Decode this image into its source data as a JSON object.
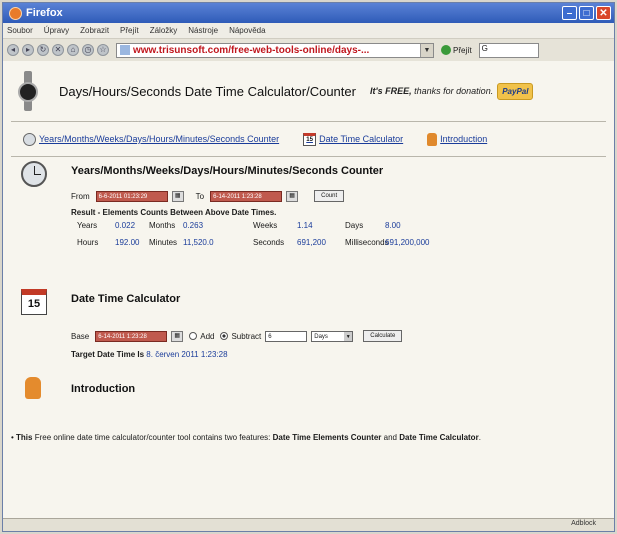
{
  "window": {
    "title": "Firefox"
  },
  "menu": [
    "Soubor",
    "Úpravy",
    "Zobrazit",
    "Přejít",
    "Záložky",
    "Nástroje",
    "Nápověda"
  ],
  "nav": {
    "url": "www.trisunsoft.com/free-web-tools-online/days-...",
    "go_label": "Přejít",
    "search_value": "G"
  },
  "header": {
    "title": "Days/Hours/Seconds Date Time Calculator/Counter",
    "free_prefix": "It's FREE,",
    "free_suffix": "thanks for donation.",
    "paypal": "PayPal"
  },
  "tabs": [
    {
      "label": "Years/Months/Weeks/Days/Hours/Minutes/Seconds Counter"
    },
    {
      "label": "Date Time Calculator",
      "icon_text": "15"
    },
    {
      "label": "Introduction"
    }
  ],
  "counter": {
    "title": "Years/Months/Weeks/Days/Hours/Minutes/Seconds Counter",
    "from_label": "From",
    "from_value": "6-6-2011 01:23:29",
    "to_label": "To",
    "to_value": "6-14-2011 1:23:28",
    "count_button": "Count",
    "result_title": "Result - Elements Counts Between Above Date Times.",
    "row1": {
      "years_label": "Years",
      "years": "0.022",
      "months_label": "Months",
      "months": "0.263",
      "weeks_label": "Weeks",
      "weeks": "1.14",
      "days_label": "Days",
      "days": "8.00"
    },
    "row2": {
      "hours_label": "Hours",
      "hours": "192.00",
      "minutes_label": "Minutes",
      "minutes": "11,520.0",
      "seconds_label": "Seconds",
      "seconds": "691,200",
      "ms_label": "Milliseconds",
      "ms": "691,200,000"
    }
  },
  "calculator": {
    "title": "Date Time Calculator",
    "icon_text": "15",
    "base_label": "Base",
    "base_value": "6-14-2011 1:23:28",
    "add_label": "Add",
    "subtract_label": "Subtract",
    "amount": "6",
    "unit": "Days",
    "calculate_button": "Calculate",
    "target_label": "Target Date Time Is",
    "target_value": "8. červen 2011 1:23:28"
  },
  "intro": {
    "title": "Introduction",
    "p1": "This",
    "p2": "Free online date time calculator/counter tool contains two features:",
    "p3": "Date Time Elements Counter",
    "p4": "and",
    "p5": "Date Time Calculator",
    "p6": "."
  },
  "status": {
    "text": "Adblock"
  }
}
